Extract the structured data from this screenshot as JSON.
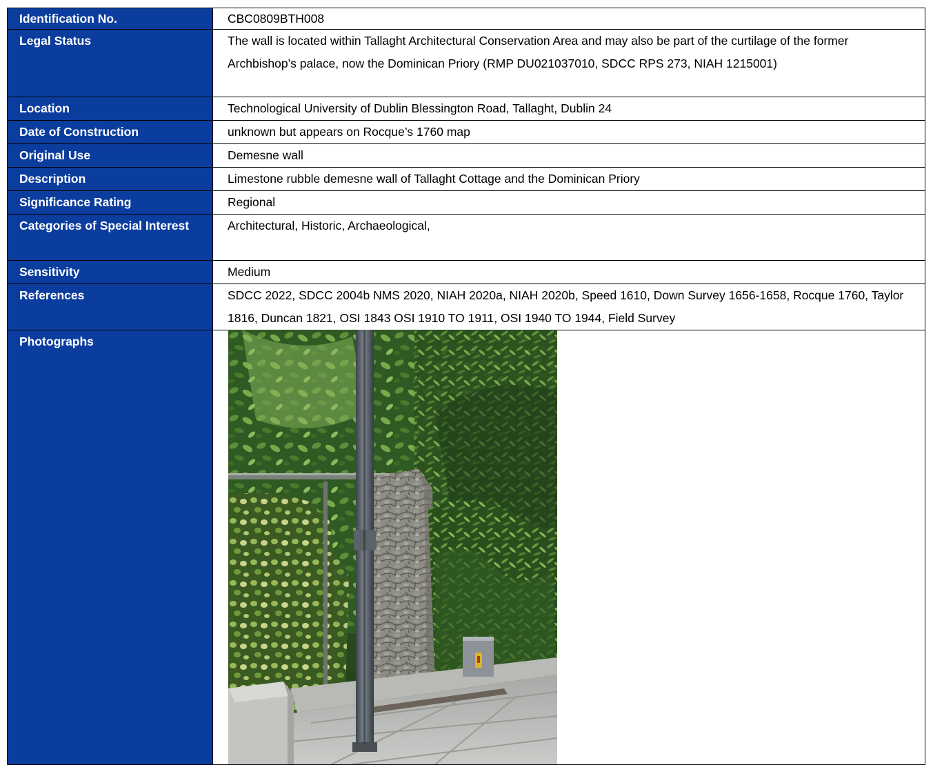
{
  "record": {
    "rows": [
      {
        "label": "Identification No.",
        "value": "CBC0809BTH008"
      },
      {
        "label": "Legal Status",
        "value": "The wall is located within Tallaght Architectural Conservation Area and may also be part of the curtilage of the former Archbishop’s palace, now the Dominican Priory (RMP DU021037010, SDCC RPS 273, NIAH 1215001)"
      },
      {
        "label": "Location",
        "value": "Technological University of Dublin Blessington Road, Tallaght, Dublin 24"
      },
      {
        "label": "Date of Construction",
        "value": "unknown but appears on Rocque’s 1760 map"
      },
      {
        "label": "Original Use",
        "value": "Demesne wall"
      },
      {
        "label": "Description",
        "value": "Limestone rubble demesne wall of Tallaght Cottage and the Dominican Priory"
      },
      {
        "label": "Significance Rating",
        "value": "Regional"
      },
      {
        "label": "Categories of Special Interest",
        "value": "Architectural, Historic, Archaeological,"
      },
      {
        "label": "Sensitivity",
        "value": "Medium"
      },
      {
        "label": "References",
        "value": "SDCC 2022, SDCC 2004b NMS 2020, NIAH 2020a, NIAH 2020b, Speed 1610, Down Survey 1656-1658, Rocque 1760, Taylor 1816, Duncan 1821, OSI 1843 OSI 1910 TO 1911, OSI 1940 TO 1944, Field Survey"
      },
      {
        "label": "Photographs",
        "value": ""
      }
    ]
  },
  "colors": {
    "label_background": "#0b3d9e",
    "label_text": "#ffffff"
  }
}
